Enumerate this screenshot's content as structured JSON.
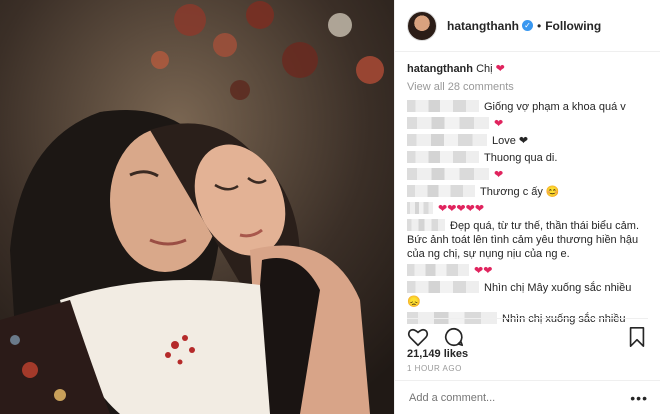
{
  "post": {
    "username": "hatangthanh",
    "follow_status": "Following",
    "caption_text": "Chị",
    "caption_emoji": "❤",
    "view_all": "View all 28 comments",
    "likes": "21,149 likes",
    "time_ago": "1 HOUR AGO",
    "add_comment_placeholder": "Add a comment...",
    "more": "•••"
  },
  "comments": [
    {
      "text": "Giống vợ phạm a khoa quá v"
    },
    {
      "text": "❤"
    },
    {
      "text": "Love ❤"
    },
    {
      "text": "Thuong qua di."
    },
    {
      "text": "❤"
    },
    {
      "text": "Thương c ấy 😊"
    },
    {
      "text": "❤❤❤❤❤"
    },
    {
      "text": "Đẹp quá, từ tư thế, thần thái biểu cảm. Bức ảnh toát lên tình cảm yêu thương hiền hậu của ng chị, sự nụng nịu của ng e."
    },
    {
      "text": "❤❤"
    },
    {
      "text": "Nhìn chị Mây xuống sắc nhiều 😞"
    },
    {
      "text": "Nhìn chị xuống sắc nhiều"
    }
  ],
  "icons": {
    "like": "heart-outline-icon",
    "comment": "speech-bubble-icon",
    "save": "bookmark-icon",
    "verified": "verified-badge-icon"
  },
  "colors": {
    "verified": "#3897f0",
    "heart": "#e0245e",
    "muted": "#999999",
    "text": "#262626"
  }
}
